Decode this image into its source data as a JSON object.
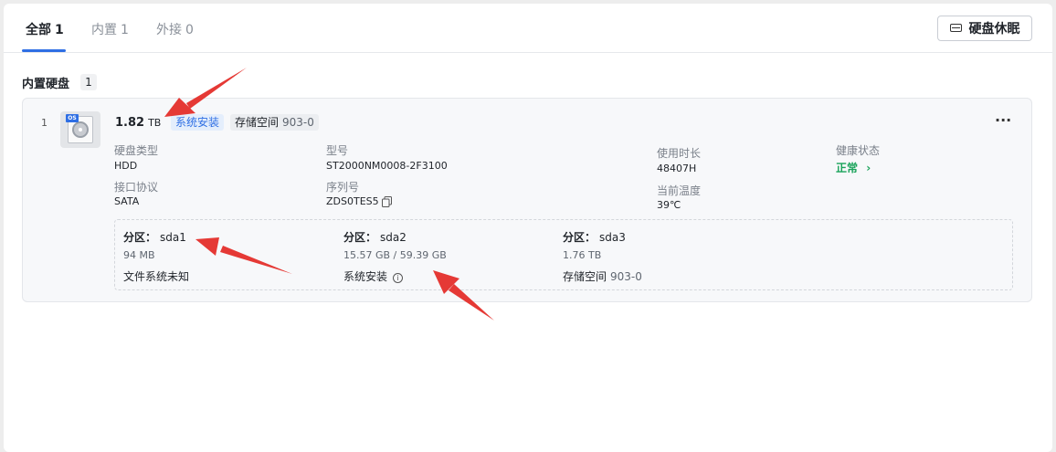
{
  "tabs": [
    {
      "label": "全部",
      "count": "1"
    },
    {
      "label": "内置",
      "count": "1"
    },
    {
      "label": "外接",
      "count": "0"
    }
  ],
  "sleep_button": {
    "label": "硬盘休眠",
    "icon": "disk-sleep-icon"
  },
  "section": {
    "title": "内置硬盘",
    "count": "1"
  },
  "disk": {
    "index": "1",
    "icon_badge": "OS",
    "size_value": "1.82",
    "size_unit": "TB",
    "tag_system": "系统安装",
    "tag_pool_label": "存储空间",
    "tag_pool_num": "903-0",
    "more_label": "···",
    "fields": {
      "disk_type_label": "硬盘类型",
      "disk_type_value": "HDD",
      "interface_label": "接口协议",
      "interface_value": "SATA",
      "model_label": "型号",
      "model_value": "ST2000NM0008-2F3100",
      "serial_label": "序列号",
      "serial_value": "ZDS0TES5",
      "uptime_label": "使用时长",
      "uptime_value": "48407H",
      "temp_label": "当前温度",
      "temp_value": "39℃",
      "health_label": "健康状态",
      "health_value": "正常",
      "health_chevron": "›"
    },
    "partitions": [
      {
        "title": "分区：",
        "name": "sda1",
        "size": "94 MB",
        "fs": "文件系统未知",
        "fs_num": ""
      },
      {
        "title": "分区：",
        "name": "sda2",
        "size": "15.57 GB / 59.39 GB",
        "fs": "系统安装",
        "fs_num": ""
      },
      {
        "title": "分区：",
        "name": "sda3",
        "size": "1.76 TB",
        "fs": "存储空间",
        "fs_num": "903-0"
      }
    ]
  },
  "colors": {
    "accent": "#2f6fe4",
    "health": "#1aa35a",
    "arrow": "#e53935"
  }
}
